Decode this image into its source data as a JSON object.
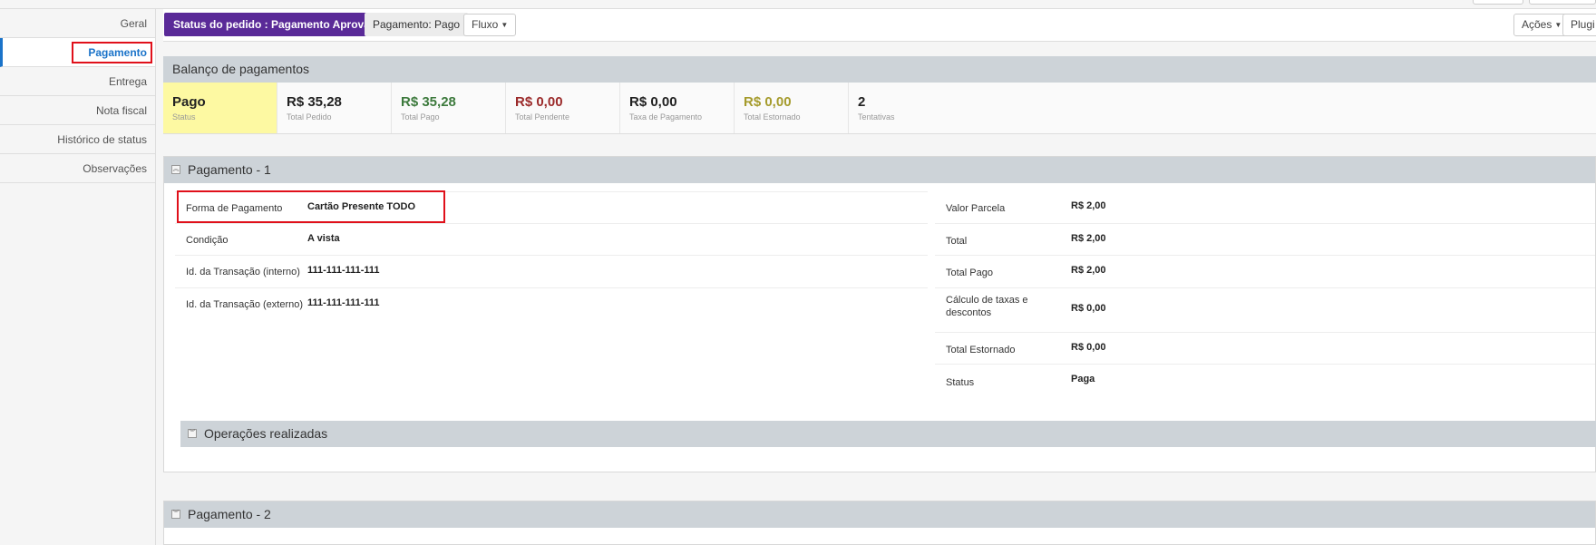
{
  "sidebar": {
    "items": [
      {
        "label": "Geral"
      },
      {
        "label": "Pagamento"
      },
      {
        "label": "Entrega"
      },
      {
        "label": "Nota fiscal"
      },
      {
        "label": "Histórico de status"
      },
      {
        "label": "Observações"
      }
    ]
  },
  "toolbar": {
    "status_badge": "Status do pedido : Pagamento Aprovado",
    "payment_badge": "Pagamento: Pago",
    "flow_button": "Fluxo",
    "actions_button": "Ações",
    "plugins_button": "Plugi"
  },
  "balance": {
    "title": "Balanço de pagamentos",
    "metrics": [
      {
        "value": "Pago",
        "caption": "Status",
        "color": "#222222"
      },
      {
        "value": "R$ 35,28",
        "caption": "Total Pedido",
        "color": "#222222"
      },
      {
        "value": "R$ 35,28",
        "caption": "Total Pago",
        "color": "#3d7a3d"
      },
      {
        "value": "R$ 0,00",
        "caption": "Total Pendente",
        "color": "#9b2a2a"
      },
      {
        "value": "R$ 0,00",
        "caption": "Taxa de Pagamento",
        "color": "#222222"
      },
      {
        "value": "R$ 0,00",
        "caption": "Total Estornado",
        "color": "#a59b2c"
      },
      {
        "value": "2",
        "caption": "Tentativas",
        "color": "#222222"
      }
    ]
  },
  "payment1": {
    "title": "Pagamento - 1",
    "left": [
      {
        "label": "Forma de Pagamento",
        "value": "Cartão Presente TODO"
      },
      {
        "label": "Condição",
        "value": "A vista"
      },
      {
        "label": "Id. da Transação (interno)",
        "value": "111-111-111-111"
      },
      {
        "label": "Id. da Transação (externo)",
        "value": "111-111-111-111"
      }
    ],
    "right": [
      {
        "label": "Valor Parcela",
        "value": "R$ 2,00"
      },
      {
        "label": "Total",
        "value": "R$ 2,00"
      },
      {
        "label": "Total Pago",
        "value": "R$ 2,00"
      },
      {
        "label": "Cálculo de taxas e descontos",
        "value": "R$ 0,00"
      },
      {
        "label": "Total Estornado",
        "value": "R$ 0,00"
      },
      {
        "label": "Status",
        "value": "Paga"
      }
    ],
    "operations_title": "Operações realizadas"
  },
  "payment2": {
    "title": "Pagamento - 2"
  },
  "icons": {
    "collapse": "collapse-icon",
    "expand": "expand-icon",
    "caret": "caret-down-icon"
  },
  "colors": {
    "status_badge": "#5a2a98",
    "active_link": "#1a73c9",
    "highlight_box": "#e0101a",
    "paid_bg": "#fdf9a2"
  }
}
